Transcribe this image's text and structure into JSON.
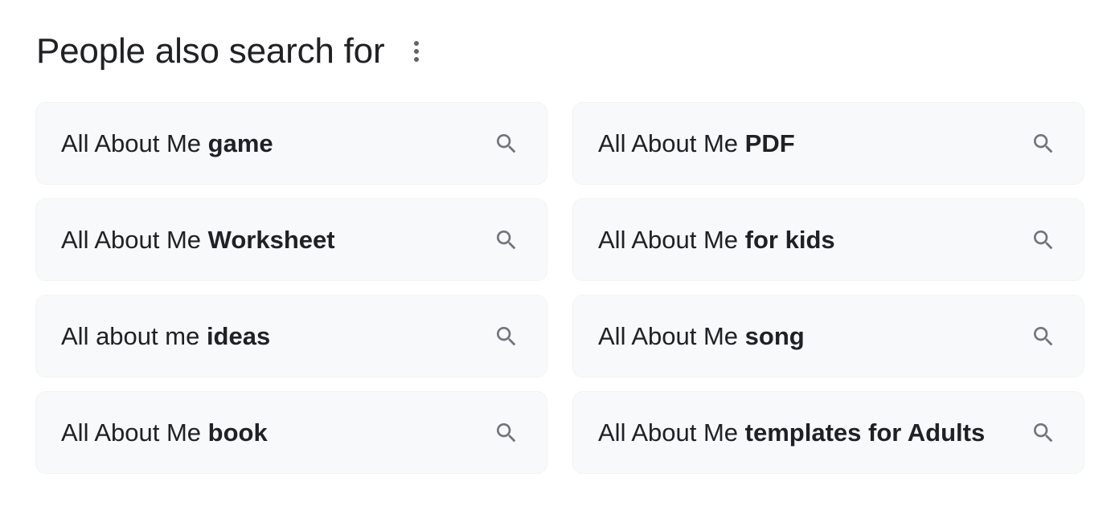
{
  "header": {
    "title": "People also search for",
    "menu_icon": "more-vert-icon"
  },
  "suggestions": [
    {
      "prefix": "All About Me ",
      "bold": "game",
      "icon": "search-icon"
    },
    {
      "prefix": "All About Me ",
      "bold": "PDF",
      "icon": "search-icon"
    },
    {
      "prefix": "All About Me ",
      "bold": "Worksheet",
      "icon": "search-icon"
    },
    {
      "prefix": "All About Me ",
      "bold": "for kids",
      "icon": "search-icon"
    },
    {
      "prefix": "All about me ",
      "bold": "ideas",
      "icon": "search-icon"
    },
    {
      "prefix": "All About Me ",
      "bold": "song",
      "icon": "search-icon"
    },
    {
      "prefix": "All About Me ",
      "bold": "book",
      "icon": "search-icon"
    },
    {
      "prefix": "All About Me ",
      "bold": "templates for Adults",
      "icon": "search-icon"
    }
  ],
  "colors": {
    "chip_background": "#f8f9fa",
    "text": "#202124",
    "icon": "#70757a"
  }
}
